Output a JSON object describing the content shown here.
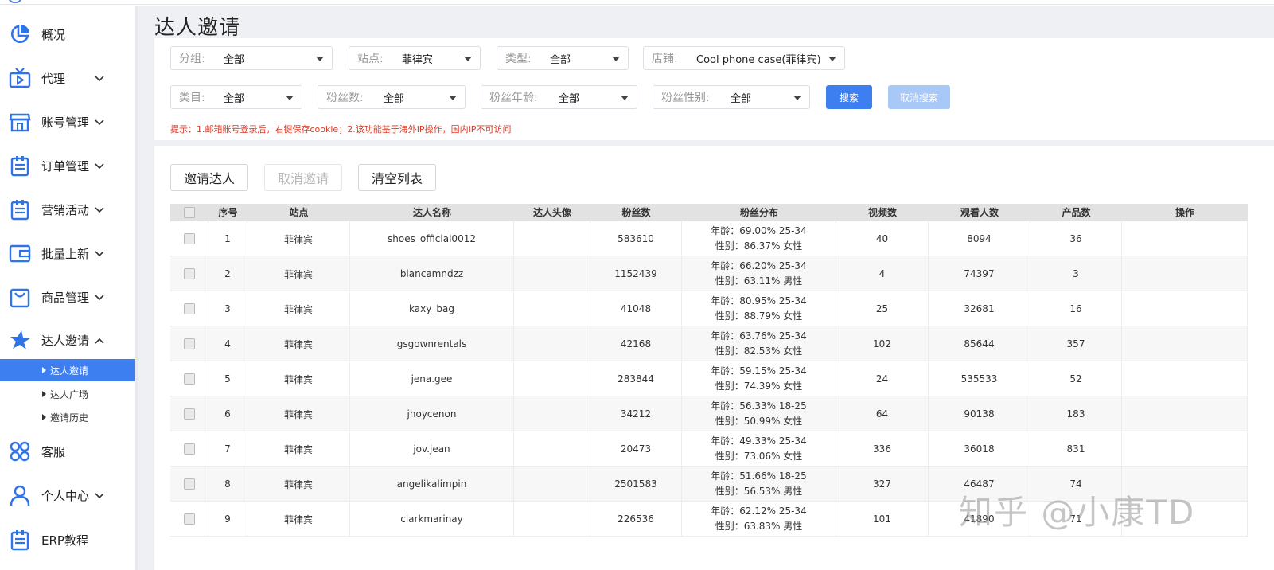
{
  "page_title": "达人邀请",
  "sidebar": {
    "items": [
      {
        "key": "overview",
        "label": "概况",
        "icon": "pie-chart-icon",
        "chevron": false
      },
      {
        "key": "agent",
        "label": "代理",
        "icon": "tv-icon",
        "chevron": "down"
      },
      {
        "key": "accounts",
        "label": "账号管理",
        "icon": "store-icon",
        "chevron": "down"
      },
      {
        "key": "orders",
        "label": "订单管理",
        "icon": "clipboard-icon",
        "chevron": "down"
      },
      {
        "key": "marketing",
        "label": "营销活动",
        "icon": "clipboard-icon",
        "chevron": "down"
      },
      {
        "key": "batch",
        "label": "批量上新",
        "icon": "wallet-icon",
        "chevron": "down"
      },
      {
        "key": "products",
        "label": "商品管理",
        "icon": "bag-icon",
        "chevron": "down"
      },
      {
        "key": "influencer",
        "label": "达人邀请",
        "icon": "star-icon",
        "chevron": "up"
      },
      {
        "key": "service",
        "label": "客服",
        "icon": "clover-icon",
        "chevron": false
      },
      {
        "key": "profile",
        "label": "个人中心",
        "icon": "user-icon",
        "chevron": "down"
      },
      {
        "key": "erp",
        "label": "ERP教程",
        "icon": "clipboard-icon",
        "chevron": false
      }
    ],
    "subitems": [
      {
        "label": "达人邀请",
        "active": true
      },
      {
        "label": "达人广场",
        "active": false
      },
      {
        "label": "邀请历史",
        "active": false
      }
    ]
  },
  "filters": {
    "group": {
      "label": "分组:",
      "value": "全部"
    },
    "site": {
      "label": "站点:",
      "value": "菲律宾"
    },
    "type": {
      "label": "类型:",
      "value": "全部"
    },
    "shop": {
      "label": "店铺:",
      "value": "Cool phone case(菲律宾)"
    },
    "category": {
      "label": "类目:",
      "value": "全部"
    },
    "fans": {
      "label": "粉丝数:",
      "value": "全部"
    },
    "fans_age": {
      "label": "粉丝年龄:",
      "value": "全部"
    },
    "fans_gender": {
      "label": "粉丝性别:",
      "value": "全部"
    },
    "search_label": "搜索",
    "cancel_search_label": "取消搜索",
    "tip": "提示：1.邮箱账号登录后，右键保存cookie；2.该功能基于海外IP操作，国内IP不可访问"
  },
  "actions": {
    "invite": "邀请达人",
    "cancel_invite": "取消邀请",
    "clear": "清空列表"
  },
  "table": {
    "columns": [
      "序号",
      "站点",
      "达人名称",
      "达人头像",
      "粉丝数",
      "粉丝分布",
      "视频数",
      "观看人数",
      "产品数",
      "操作"
    ],
    "rows": [
      {
        "no": "1",
        "site": "菲律宾",
        "name": "shoes_official0012",
        "fans": "583610",
        "age": "年龄：69.00% 25-34",
        "gender": "性别：86.37% 女性",
        "videos": "40",
        "views": "8094",
        "products": "36"
      },
      {
        "no": "2",
        "site": "菲律宾",
        "name": "biancamndzz",
        "fans": "1152439",
        "age": "年龄：66.20% 25-34",
        "gender": "性别：63.11% 男性",
        "videos": "4",
        "views": "74397",
        "products": "3"
      },
      {
        "no": "3",
        "site": "菲律宾",
        "name": "kaxy_bag",
        "fans": "41048",
        "age": "年龄：80.95% 25-34",
        "gender": "性别：88.79% 女性",
        "videos": "25",
        "views": "32681",
        "products": "16"
      },
      {
        "no": "4",
        "site": "菲律宾",
        "name": "gsgownrentals",
        "fans": "42168",
        "age": "年龄：63.76% 25-34",
        "gender": "性别：82.53% 女性",
        "videos": "102",
        "views": "85644",
        "products": "357"
      },
      {
        "no": "5",
        "site": "菲律宾",
        "name": "jena.gee",
        "fans": "283844",
        "age": "年龄：59.15% 25-34",
        "gender": "性别：74.39% 女性",
        "videos": "24",
        "views": "535533",
        "products": "52"
      },
      {
        "no": "6",
        "site": "菲律宾",
        "name": "jhoycenon",
        "fans": "34212",
        "age": "年龄：56.33% 18-25",
        "gender": "性别：50.99% 女性",
        "videos": "64",
        "views": "90138",
        "products": "183"
      },
      {
        "no": "7",
        "site": "菲律宾",
        "name": "jov.jean",
        "fans": "20473",
        "age": "年龄：49.33% 25-34",
        "gender": "性别：73.06% 女性",
        "videos": "336",
        "views": "36018",
        "products": "831"
      },
      {
        "no": "8",
        "site": "菲律宾",
        "name": "angelikalimpin",
        "fans": "2501583",
        "age": "年龄：51.66% 18-25",
        "gender": "性别：56.53% 男性",
        "videos": "327",
        "views": "46487",
        "products": "74"
      },
      {
        "no": "9",
        "site": "菲律宾",
        "name": "clarkmarinay",
        "fans": "226536",
        "age": "年龄：62.12% 25-34",
        "gender": "性别：63.83% 男性",
        "videos": "101",
        "views": "41890",
        "products": "71"
      }
    ]
  },
  "watermark": "知乎 @小康TD",
  "colors": {
    "primary": "#3d7ff0",
    "icon_blue": "#2f73e8",
    "disabled_primary": "#a8c8f8",
    "tip_red": "#d93a26"
  }
}
